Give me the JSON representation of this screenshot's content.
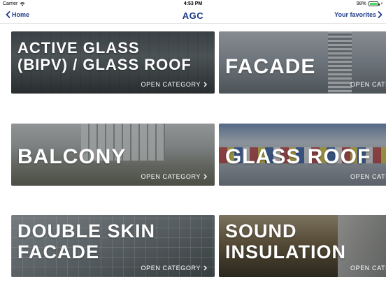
{
  "status_bar": {
    "carrier": "Carrier",
    "time": "4:53 PM",
    "battery": "98%",
    "battery_level": 0.98
  },
  "nav": {
    "back_label": "Home",
    "title": "AGC",
    "favorites_label": "Your favorites",
    "accent_color": "#1d3a8a"
  },
  "tiles": [
    {
      "title_line1": "ACTIVE GLASS",
      "title_line2": "(BIPV) / GLASS ROOF",
      "cta": "OPEN CATEGORY"
    },
    {
      "title_line1": "FACADE",
      "title_line2": "",
      "cta": "OPEN CATE"
    },
    {
      "title_line1": "BALCONY",
      "title_line2": "",
      "cta": "OPEN CATEGORY"
    },
    {
      "title_line1": "GLASS ROOF",
      "title_line2": "",
      "cta": "OPEN CATE"
    },
    {
      "title_line1": "DOUBLE SKIN",
      "title_line2": "FACADE",
      "cta": "OPEN CATEGORY"
    },
    {
      "title_line1": "SOUND",
      "title_line2": "INSULATION",
      "cta": "OPEN CATE"
    }
  ]
}
